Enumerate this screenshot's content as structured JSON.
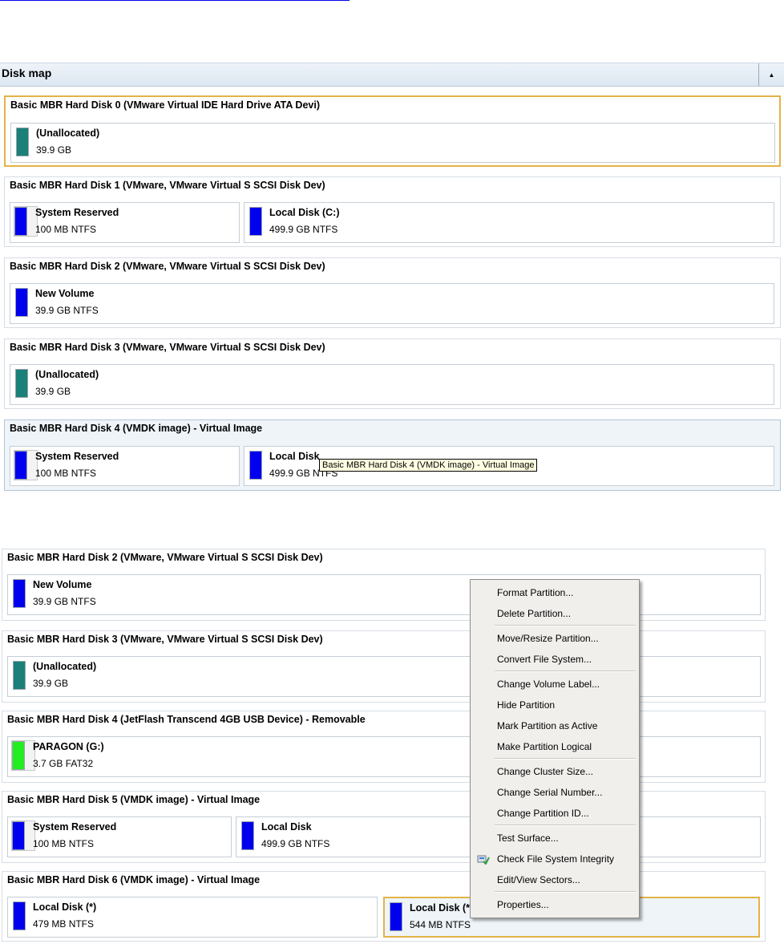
{
  "panel": {
    "title": "Disk map",
    "collapse_icon": "triangle-up-icon"
  },
  "colors": {
    "ntfs": "#0000ee",
    "unallocated": "#1a8078",
    "fat32": "#22ee22",
    "selection": "#e3b348"
  },
  "top_disks": [
    {
      "title": "Basic MBR Hard Disk 0 (VMware Virtual IDE Hard Drive ATA Devi)",
      "partitions": [
        {
          "name": "(Unallocated)",
          "size": "39.9 GB",
          "color": "unallocated"
        }
      ]
    },
    {
      "title": "Basic MBR Hard Disk 1 (VMware, VMware Virtual S SCSI Disk Dev)",
      "partitions": [
        {
          "name": "System Reserved",
          "size": "100 MB NTFS",
          "color": "ntfs"
        },
        {
          "name": "Local Disk (C:)",
          "size": "499.9 GB NTFS",
          "color": "ntfs"
        }
      ]
    },
    {
      "title": "Basic MBR Hard Disk 2 (VMware, VMware Virtual S SCSI Disk Dev)",
      "partitions": [
        {
          "name": "New Volume",
          "size": "39.9 GB NTFS",
          "color": "ntfs"
        }
      ]
    },
    {
      "title": "Basic MBR Hard Disk 3 (VMware, VMware Virtual S SCSI Disk Dev)",
      "partitions": [
        {
          "name": "(Unallocated)",
          "size": "39.9 GB",
          "color": "unallocated"
        }
      ]
    },
    {
      "title": "Basic MBR Hard Disk 4 (VMDK image) - Virtual Image",
      "partitions": [
        {
          "name": "System Reserved",
          "size": "100 MB NTFS",
          "color": "ntfs"
        },
        {
          "name": "Local Disk",
          "size": "499.9 GB NTFS",
          "color": "ntfs"
        }
      ]
    }
  ],
  "tooltip": "Basic MBR Hard Disk 4 (VMDK image) - Virtual Image",
  "bottom_disks": [
    {
      "title": "Basic MBR Hard Disk 2 (VMware, VMware Virtual S SCSI Disk Dev)",
      "partitions": [
        {
          "name": "New Volume",
          "size": "39.9 GB NTFS",
          "color": "ntfs"
        }
      ]
    },
    {
      "title": "Basic MBR Hard Disk 3 (VMware, VMware Virtual S SCSI Disk Dev)",
      "partitions": [
        {
          "name": "(Unallocated)",
          "size": "39.9 GB",
          "color": "unallocated"
        }
      ]
    },
    {
      "title": "Basic MBR Hard Disk 4 (JetFlash Transcend 4GB USB Device) - Removable",
      "partitions": [
        {
          "name": "PARAGON (G:)",
          "size": "3.7 GB FAT32",
          "color": "fat32"
        }
      ]
    },
    {
      "title": "Basic MBR Hard Disk 5 (VMDK image) - Virtual Image",
      "partitions": [
        {
          "name": "System Reserved",
          "size": "100 MB NTFS",
          "color": "ntfs"
        },
        {
          "name": "Local Disk",
          "size": "499.9 GB NTFS",
          "color": "ntfs"
        }
      ]
    },
    {
      "title": "Basic MBR Hard Disk 6 (VMDK image) - Virtual Image",
      "partitions": [
        {
          "name": "Local Disk (*)",
          "size": "479 MB NTFS",
          "color": "ntfs"
        },
        {
          "name": "Local Disk (*)",
          "size": "544 MB NTFS",
          "color": "ntfs"
        }
      ]
    }
  ],
  "context_menu": {
    "groups": [
      [
        {
          "label": "Format Partition..."
        },
        {
          "label": "Delete Partition..."
        }
      ],
      [
        {
          "label": "Move/Resize Partition..."
        },
        {
          "label": "Convert File System..."
        }
      ],
      [
        {
          "label": "Change Volume Label..."
        },
        {
          "label": "Hide Partition"
        },
        {
          "label": "Mark Partition as Active"
        },
        {
          "label": "Make Partition Logical"
        }
      ],
      [
        {
          "label": "Change Cluster Size..."
        },
        {
          "label": "Change Serial Number..."
        },
        {
          "label": "Change Partition ID..."
        }
      ],
      [
        {
          "label": "Test Surface..."
        },
        {
          "label": "Check File System Integrity",
          "icon": "check-disk-icon"
        },
        {
          "label": "Edit/View Sectors..."
        }
      ],
      [
        {
          "label": "Properties..."
        }
      ]
    ]
  }
}
